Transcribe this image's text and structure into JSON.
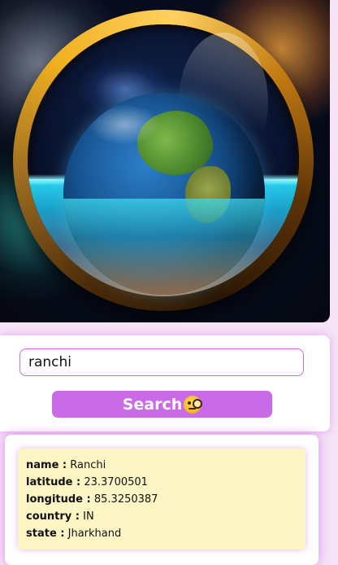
{
  "hero": {
    "image_description_icon": "globe-icon"
  },
  "search": {
    "input_value": "ranchi",
    "button_label": "Search",
    "button_emoji_icon": "face-with-monocle-icon",
    "accent_color": "#c96be6"
  },
  "result": {
    "rows": [
      {
        "key": "name :",
        "value": "Ranchi"
      },
      {
        "key": "latitude :",
        "value": "23.3700501"
      },
      {
        "key": "longitude :",
        "value": "85.3250387"
      },
      {
        "key": "country :",
        "value": "IN"
      },
      {
        "key": "state :",
        "value": "Jharkhand"
      }
    ],
    "box_color": "#fdf5c4"
  }
}
